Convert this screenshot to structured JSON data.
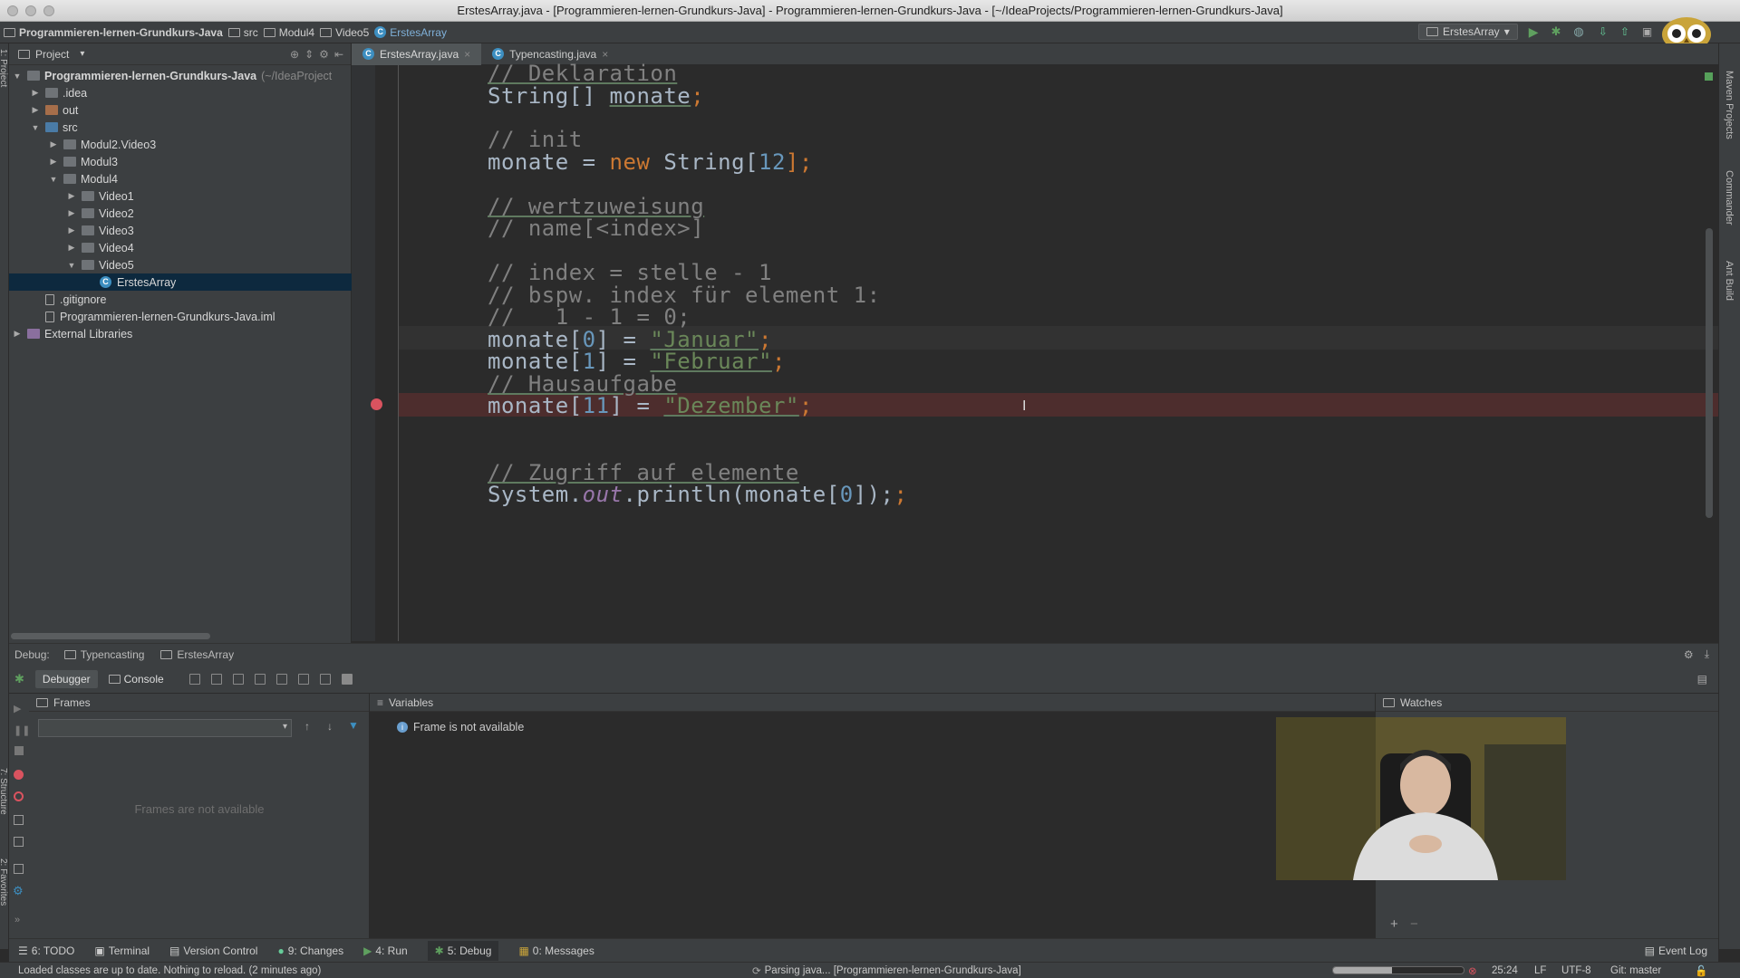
{
  "window": {
    "title": "ErstesArray.java - [Programmieren-lernen-Grundkurs-Java] - Programmieren-lernen-Grundkurs-Java - [~/IdeaProjects/Programmieren-lernen-Grundkurs-Java]"
  },
  "breadcrumbs": [
    "Programmieren-lernen-Grundkurs-Java",
    "src",
    "Modul4",
    "Video5",
    "ErstesArray"
  ],
  "run_config": "ErstesArray",
  "project_panel": {
    "title": "Project",
    "tree": [
      {
        "label": "Programmieren-lernen-Grundkurs-Java",
        "suffix": "(~/IdeaProject",
        "level": 0,
        "arrow": "▼",
        "icon": "folder"
      },
      {
        "label": ".idea",
        "level": 1,
        "arrow": "▶",
        "icon": "folder"
      },
      {
        "label": "out",
        "level": 1,
        "arrow": "▶",
        "icon": "folder-orange"
      },
      {
        "label": "src",
        "level": 1,
        "arrow": "▼",
        "icon": "folder-blue"
      },
      {
        "label": "Modul2.Video3",
        "level": 2,
        "arrow": "▶",
        "icon": "package"
      },
      {
        "label": "Modul3",
        "level": 2,
        "arrow": "▶",
        "icon": "package"
      },
      {
        "label": "Modul4",
        "level": 2,
        "arrow": "▼",
        "icon": "package"
      },
      {
        "label": "Video1",
        "level": 3,
        "arrow": "▶",
        "icon": "package"
      },
      {
        "label": "Video2",
        "level": 3,
        "arrow": "▶",
        "icon": "package"
      },
      {
        "label": "Video3",
        "level": 3,
        "arrow": "▶",
        "icon": "package"
      },
      {
        "label": "Video4",
        "level": 3,
        "arrow": "▶",
        "icon": "package"
      },
      {
        "label": "Video5",
        "level": 3,
        "arrow": "▼",
        "icon": "package"
      },
      {
        "label": "ErstesArray",
        "level": 4,
        "arrow": "",
        "icon": "class",
        "selected": true
      },
      {
        "label": ".gitignore",
        "level": 1,
        "arrow": "",
        "icon": "file"
      },
      {
        "label": "Programmieren-lernen-Grundkurs-Java.iml",
        "level": 1,
        "arrow": "",
        "icon": "iml"
      },
      {
        "label": "External Libraries",
        "level": 0,
        "arrow": "▶",
        "icon": "library"
      }
    ]
  },
  "editor_tabs": [
    {
      "label": "ErstesArray.java",
      "active": true
    },
    {
      "label": "Typencasting.java",
      "active": false
    }
  ],
  "code": {
    "l1": "// Deklaration",
    "l2_a": "String[] ",
    "l2_b": "monate",
    "l2_c": ";",
    "l3": "// init",
    "l4_a": "monate = ",
    "l4_b": "new",
    "l4_c": " String[",
    "l4_d": "12",
    "l4_e": "];",
    "l5": "// wertzuweisung",
    "l6": "// name[<index>]",
    "l7": "// index = stelle - 1",
    "l8": "// bspw. index für element 1:",
    "l9": "//   1 - 1 = 0;",
    "l10_a": "monate[",
    "l10_b": "0",
    "l10_c": "] = ",
    "l10_d": "\"Januar\"",
    "l10_e": ";",
    "l11_a": "monate[",
    "l11_b": "1",
    "l11_c": "] = ",
    "l11_d": "\"Februar\"",
    "l11_e": ";",
    "l12": "// Hausaufgabe",
    "l13_a": "monate[",
    "l13_b": "11",
    "l13_c": "] = ",
    "l13_d": "\"Dezember\"",
    "l13_e": ";",
    "l14": "// Zugriff auf elemente",
    "l15_a": "System.",
    "l15_b": "out",
    "l15_c": ".println(monate[",
    "l15_d": "0",
    "l15_e": "]);"
  },
  "debug": {
    "label": "Debug:",
    "sessions": [
      "Typencasting",
      "ErstesArray"
    ],
    "tabs": [
      "Debugger",
      "Console"
    ],
    "frames_title": "Frames",
    "frames_empty": "Frames are not available",
    "variables_title": "Variables",
    "variables_msg": "Frame is not available",
    "watches_title": "Watches"
  },
  "bottom_tools": [
    {
      "label": "6: TODO"
    },
    {
      "label": "Terminal"
    },
    {
      "label": "Version Control"
    },
    {
      "label": "9: Changes"
    },
    {
      "label": "4: Run"
    },
    {
      "label": "5: Debug",
      "selected": true
    },
    {
      "label": "0: Messages"
    }
  ],
  "event_log": "Event Log",
  "status": {
    "left": "Loaded classes are up to date. Nothing to reload. (2 minutes ago)",
    "center": "Parsing java... [Programmieren-lernen-Grundkurs-Java]",
    "position": "25:24",
    "line_sep": "LF",
    "encoding": "UTF-8",
    "vcs": "Git: master"
  },
  "side_tabs": {
    "left_top": "1: Project",
    "left_bottom": "7: Structure",
    "favorites": "2: Favorites",
    "right": [
      "Maven Projects",
      "Commander",
      "Ant Build"
    ]
  },
  "colors": {
    "breakpoint": "#d9535f",
    "selection": "#0d293e",
    "accent": "#3d8fc1"
  }
}
